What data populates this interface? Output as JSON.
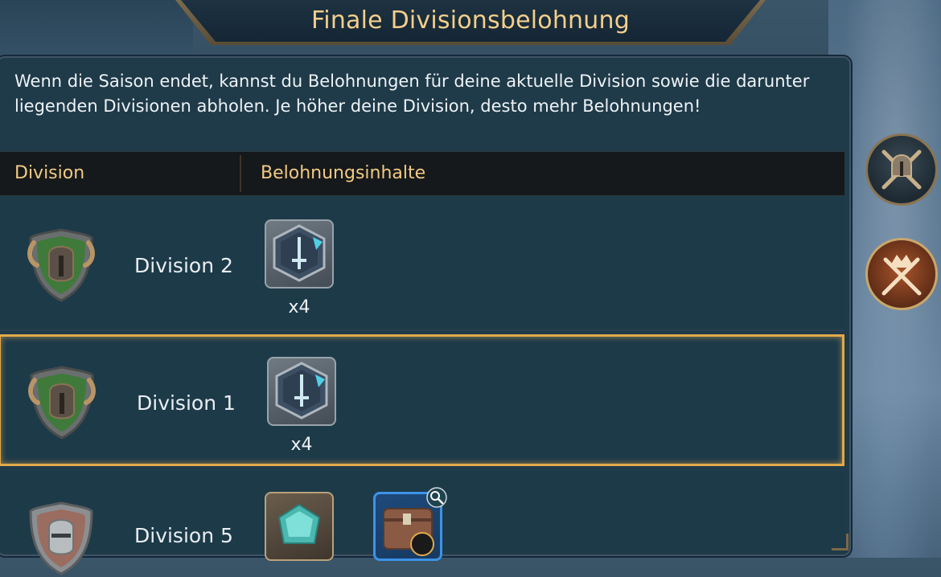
{
  "title": "Finale Divisionsbelohnung",
  "intro": "Wenn die Saison endet, kannst du Belohnungen für deine aktuelle Division sowie die darunter liegenden Divisionen abholen. Je höher deine Division, desto mehr Belohnungen!",
  "table": {
    "col_division": "Division",
    "col_rewards": "Belohnungsinhalte"
  },
  "rows": [
    {
      "division": "Division 2",
      "shield": "green-horned-helmet-shield-icon",
      "rewards": [
        {
          "icon": "sword-token-icon",
          "qty": "x4"
        }
      ]
    },
    {
      "division": "Division 1",
      "shield": "green-horned-helmet-shield-icon",
      "rewards": [
        {
          "icon": "sword-token-icon",
          "qty": "x4"
        }
      ],
      "selected": true
    },
    {
      "division": "Division 5",
      "shield": "silver-helmet-shield-icon",
      "rewards": [
        {
          "icon": "crystal-gem-icon"
        },
        {
          "icon": "treasure-chest-icon"
        }
      ]
    }
  ],
  "side_buttons": [
    {
      "icon": "spartan-helmet-swords-icon",
      "active": false
    },
    {
      "icon": "crown-swords-icon",
      "active": true
    }
  ],
  "colors": {
    "accent_gold": "#f2c983",
    "panel": "#1f3a49",
    "selected_border": "#e2a94a"
  }
}
